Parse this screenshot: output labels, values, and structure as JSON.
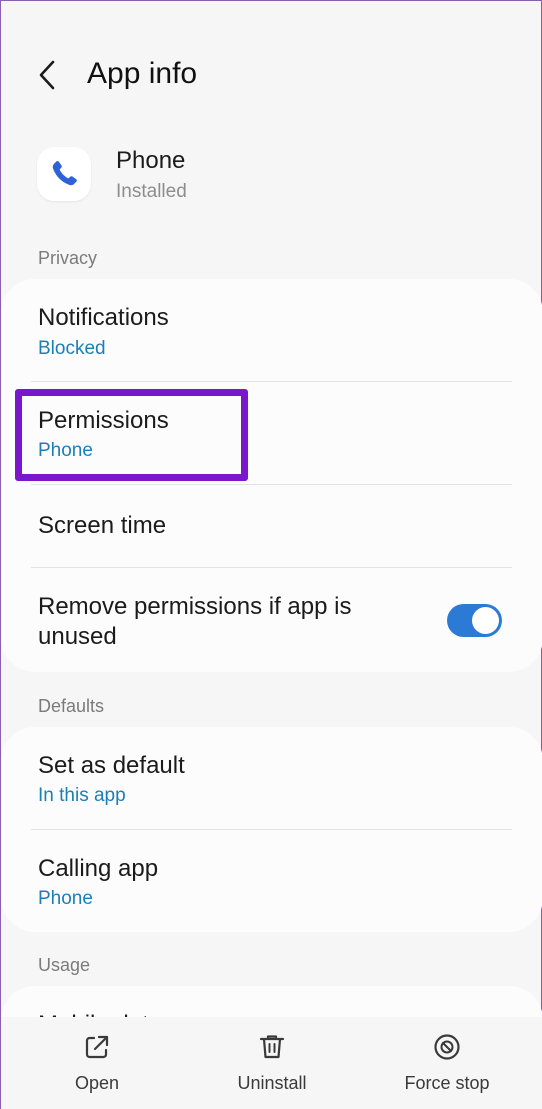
{
  "header": {
    "title": "App info"
  },
  "app": {
    "name": "Phone",
    "status": "Installed"
  },
  "sections": {
    "privacy": "Privacy",
    "defaults": "Defaults",
    "usage": "Usage"
  },
  "privacy_items": {
    "notifications": {
      "title": "Notifications",
      "sub": "Blocked"
    },
    "permissions": {
      "title": "Permissions",
      "sub": "Phone"
    },
    "screen_time": {
      "title": "Screen time"
    },
    "remove_permissions": {
      "title": "Remove permissions if app is unused",
      "enabled": true
    }
  },
  "defaults_items": {
    "set_default": {
      "title": "Set as default",
      "sub": "In this app"
    },
    "calling_app": {
      "title": "Calling app",
      "sub": "Phone"
    }
  },
  "usage_items": {
    "mobile_data": {
      "title": "Mobile data"
    }
  },
  "bottom_bar": {
    "open": "Open",
    "uninstall": "Uninstall",
    "force_stop": "Force stop"
  },
  "colors": {
    "accent": "#1b7fb7",
    "toggle_on": "#2b7bd6",
    "highlight": "#7a16cc",
    "icon_blue": "#2d63d6"
  },
  "icons": [
    "back-arrow-icon",
    "phone-icon",
    "open-external-icon",
    "trash-icon",
    "force-stop-icon"
  ]
}
